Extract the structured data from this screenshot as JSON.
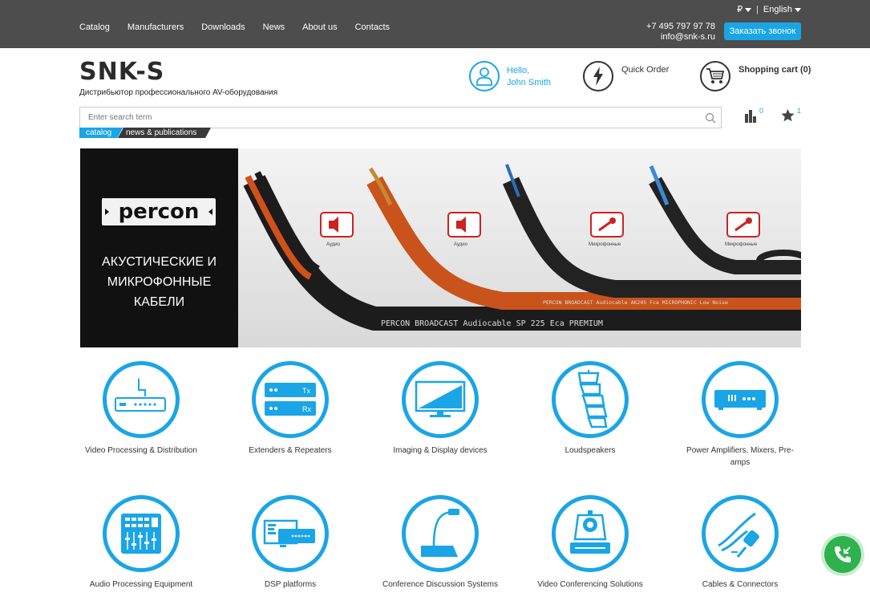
{
  "topbar": {
    "nav": [
      "Catalog",
      "Manufacturers",
      "Downloads",
      "News",
      "About us",
      "Contacts"
    ],
    "currency": "₽",
    "language": "English",
    "phone": "+7 495 797 97 78",
    "email": "info@snk-s.ru",
    "callback_label": "Заказать звонок"
  },
  "header": {
    "logo": "SNK-S",
    "tagline": "Дистрибьютор профессионального AV-оборудования",
    "hello_line1": "Hello,",
    "hello_line2": "John Smith",
    "quick_order": "Quick Order",
    "cart": "Shopping cart (0)"
  },
  "search": {
    "placeholder": "Enter search term",
    "compare_count": "0",
    "favorites_count": "1"
  },
  "crumbs": [
    "catalog",
    "news & publications"
  ],
  "banner": {
    "brand": "percon",
    "text": [
      "АКУСТИЧЕСКИЕ И",
      "МИКРОФОННЫЕ",
      "КАБЕЛИ"
    ],
    "cable1_label": "PERCON BROADCAST Audiocable SP 225 Eca PREMIUM",
    "cable2_label": "PERCON BROADCAST Audiocable AK205 Fca MICROPHONIC Low Noise",
    "badges": [
      "Аудио",
      "Аудио",
      "Микрофонные",
      "Микрофонные"
    ]
  },
  "categories": [
    {
      "label": "Video Processing & Distribution",
      "icon": "video-processing-icon"
    },
    {
      "label": "Extenders & Repeaters",
      "icon": "extenders-icon",
      "tx": "Tx",
      "rx": "Rx"
    },
    {
      "label": "Imaging & Display devices",
      "icon": "display-icon"
    },
    {
      "label": "Loudspeakers",
      "icon": "loudspeaker-icon"
    },
    {
      "label": "Power Amplifiers, Mixers, Pre-amps",
      "icon": "amplifier-icon"
    },
    {
      "label": "Audio Processing Equipment",
      "icon": "audio-mixer-icon"
    },
    {
      "label": "DSP platforms",
      "icon": "dsp-icon"
    },
    {
      "label": "Conference Discussion Systems",
      "icon": "microphone-icon"
    },
    {
      "label": "Video Conferencing Solutions",
      "icon": "ptz-camera-icon"
    },
    {
      "label": "Cables & Connectors",
      "icon": "cable-icon"
    }
  ],
  "colors": {
    "accent": "#1aa5e6",
    "topbar": "#4d4d4d",
    "fab": "#2fb24d"
  }
}
